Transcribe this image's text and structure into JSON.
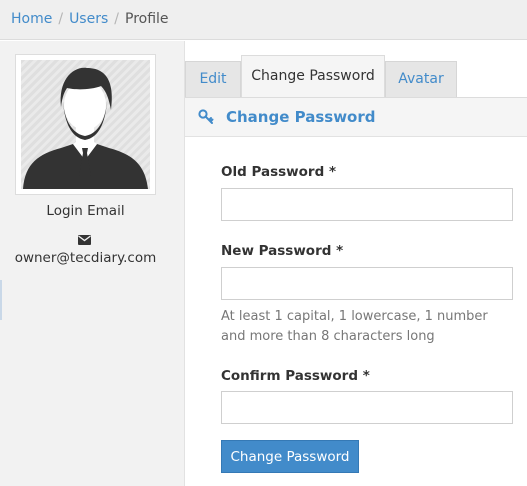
{
  "breadcrumb": {
    "home": "Home",
    "users": "Users",
    "current": "Profile"
  },
  "sidebar": {
    "login_label": "Login Email",
    "email": "owner@tecdiary.com"
  },
  "tabs": {
    "edit": "Edit",
    "change_password": "Change Password",
    "avatar": "Avatar"
  },
  "panel": {
    "title": "Change Password"
  },
  "form": {
    "old_password_label": "Old Password *",
    "old_password_value": "",
    "new_password_label": "New Password *",
    "new_password_value": "",
    "help_text": "At least 1 capital, 1 lowercase, 1 number and more than 8 characters long",
    "confirm_password_label": "Confirm Password *",
    "confirm_password_value": "",
    "submit_label": "Change Password"
  },
  "colors": {
    "accent": "#428bca",
    "sidebar_bg": "#f2f2f2",
    "breadcrumb_bg": "#efefef"
  },
  "icons": {
    "avatar": "user-silhouette-icon",
    "mail": "envelope-icon",
    "key": "key-icon"
  }
}
